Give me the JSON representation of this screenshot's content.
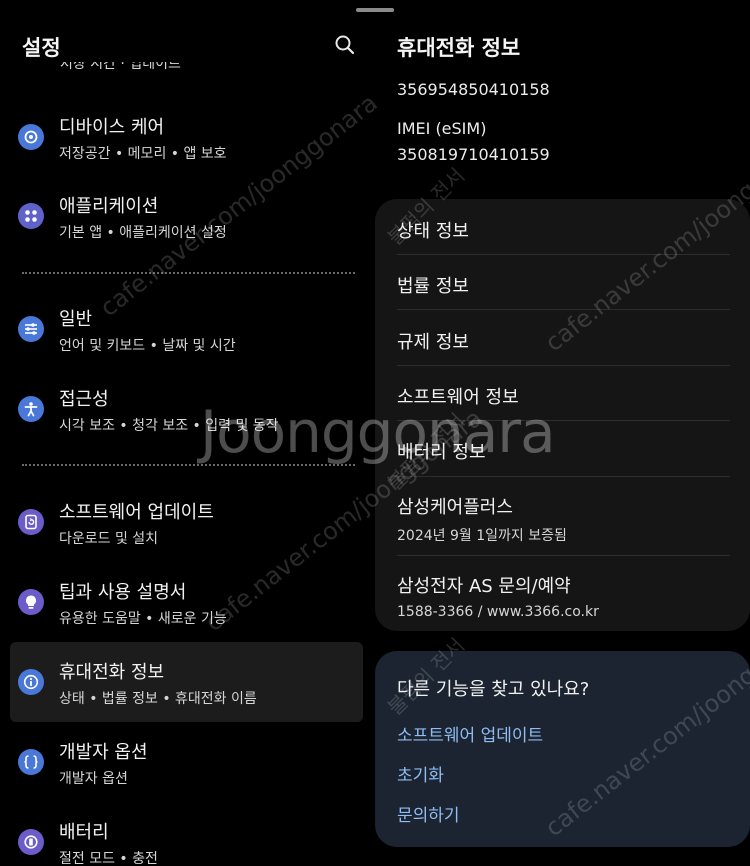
{
  "left_panel": {
    "title": "설정",
    "clipped_subtitle": "저장 시간 · 업데이트",
    "items": [
      {
        "title": "디바이스 케어",
        "subtitle": "저장공간 • 메모리 • 앱 보호",
        "icon": "device-care-icon",
        "color": "#4a78d8"
      },
      {
        "title": "애플리케이션",
        "subtitle": "기본 앱 • 애플리케이션 설정",
        "icon": "apps-grid-icon",
        "color": "#5f63c9"
      },
      {
        "title": "일반",
        "subtitle": "언어 및 키보드 • 날짜 및 시간",
        "icon": "sliders-icon",
        "color": "#4a78d8"
      },
      {
        "title": "접근성",
        "subtitle": "시각 보조 • 청각 보조 • 입력 및 동작",
        "icon": "accessibility-icon",
        "color": "#4a78d8"
      },
      {
        "title": "소프트웨어 업데이트",
        "subtitle": "다운로드 및 설치",
        "icon": "software-update-icon",
        "color": "#6b5cc9"
      },
      {
        "title": "팁과 사용 설명서",
        "subtitle": "유용한 도움말 • 새로운 기능",
        "icon": "tips-bulb-icon",
        "color": "#6b5cc9"
      },
      {
        "title": "휴대전화 정보",
        "subtitle": "상태 • 법률 정보 • 휴대전화 이름",
        "icon": "phone-info-icon",
        "color": "#4a78d8"
      },
      {
        "title": "개발자 옵션",
        "subtitle": "개발자 옵션",
        "icon": "developer-braces-icon",
        "color": "#4a78d8"
      },
      {
        "title": "배터리",
        "subtitle": "절전 모드 • 충전",
        "icon": "battery-icon",
        "color": "#6b5cc9"
      }
    ]
  },
  "right_panel": {
    "title": "휴대전화 정보",
    "imei_primary": "356954850410158",
    "imei_esim_label": "IMEI (eSIM)",
    "imei_esim": "350819710410159",
    "card_items": [
      {
        "title": "상태 정보",
        "subtitle": ""
      },
      {
        "title": "법률 정보",
        "subtitle": ""
      },
      {
        "title": "규제 정보",
        "subtitle": ""
      },
      {
        "title": "소프트웨어 정보",
        "subtitle": ""
      },
      {
        "title": "배터리 정보",
        "subtitle": ""
      },
      {
        "title": "삼성케어플러스",
        "subtitle": "2024년 9월 1일까지 보증됨"
      },
      {
        "title": "삼성전자 AS 문의/예약",
        "subtitle": "1588-3366 / www.3366.co.kr"
      }
    ],
    "help": {
      "title": "다른 기능을 찾고 있나요?",
      "links": [
        "소프트웨어 업데이트",
        "초기화",
        "문의하기"
      ]
    }
  },
  "watermarks": {
    "center": "Joonggonara",
    "diagonal": "cafe.naver.com/joonggonara",
    "stamp": "불펌의 전서"
  },
  "colors": {
    "background": "#000000",
    "card": "#151515",
    "help_card": "#1b2430",
    "link": "#8fbcf2",
    "selected": "#1c1c1c"
  }
}
